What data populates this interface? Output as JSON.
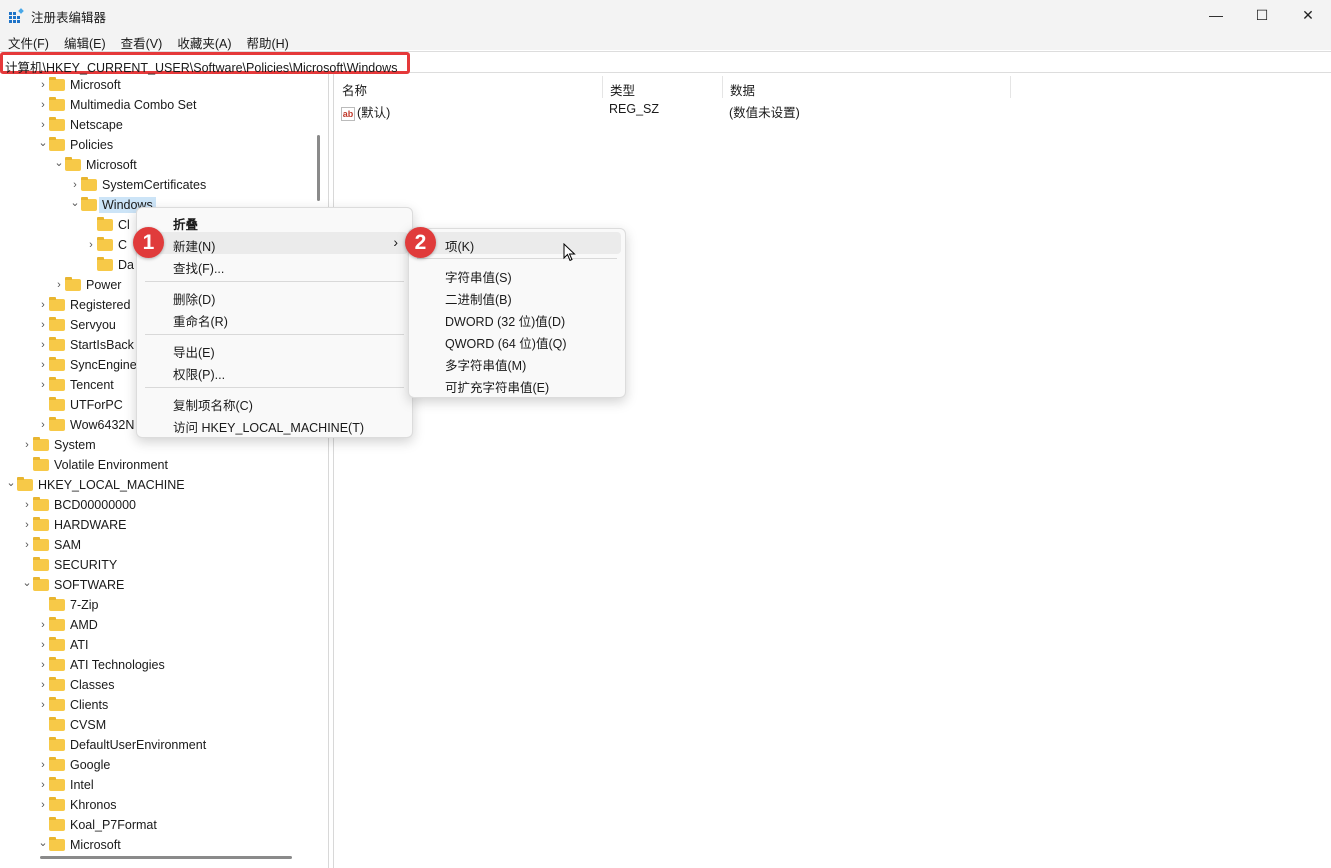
{
  "window": {
    "title": "注册表编辑器",
    "controls": {
      "minimize": "—",
      "maximize": "☐",
      "close": "✕"
    }
  },
  "menubar": [
    "文件(F)",
    "编辑(E)",
    "查看(V)",
    "收藏夹(A)",
    "帮助(H)"
  ],
  "address": "计算机\\HKEY_CURRENT_USER\\Software\\Policies\\Microsoft\\Windows",
  "tree": [
    {
      "label": "Microsoft",
      "level": 2,
      "state": "collapsed"
    },
    {
      "label": "Multimedia Combo Set",
      "level": 2,
      "state": "collapsed"
    },
    {
      "label": "Netscape",
      "level": 2,
      "state": "collapsed"
    },
    {
      "label": "Policies",
      "level": 2,
      "state": "expanded"
    },
    {
      "label": "Microsoft",
      "level": 3,
      "state": "expanded"
    },
    {
      "label": "SystemCertificates",
      "level": 4,
      "state": "collapsed"
    },
    {
      "label": "Windows",
      "level": 4,
      "state": "expanded",
      "selected": true
    },
    {
      "label": "Cl",
      "level": 5,
      "state": "leaf"
    },
    {
      "label": "C",
      "level": 5,
      "state": "collapsed"
    },
    {
      "label": "Da",
      "level": 5,
      "state": "leaf"
    },
    {
      "label": "Power",
      "level": 3,
      "state": "collapsed"
    },
    {
      "label": "Registered",
      "level": 2,
      "state": "collapsed"
    },
    {
      "label": "Servyou",
      "level": 2,
      "state": "collapsed"
    },
    {
      "label": "StartIsBack",
      "level": 2,
      "state": "collapsed"
    },
    {
      "label": "SyncEngine",
      "level": 2,
      "state": "collapsed"
    },
    {
      "label": "Tencent",
      "level": 2,
      "state": "collapsed"
    },
    {
      "label": "UTForPC",
      "level": 2,
      "state": "leaf"
    },
    {
      "label": "Wow6432N",
      "level": 2,
      "state": "collapsed"
    },
    {
      "label": "System",
      "level": 1,
      "state": "collapsed"
    },
    {
      "label": "Volatile Environment",
      "level": 1,
      "state": "leaf"
    },
    {
      "label": "HKEY_LOCAL_MACHINE",
      "level": 0,
      "state": "expanded"
    },
    {
      "label": "BCD00000000",
      "level": 1,
      "state": "collapsed"
    },
    {
      "label": "HARDWARE",
      "level": 1,
      "state": "collapsed"
    },
    {
      "label": "SAM",
      "level": 1,
      "state": "collapsed"
    },
    {
      "label": "SECURITY",
      "level": 1,
      "state": "leaf"
    },
    {
      "label": "SOFTWARE",
      "level": 1,
      "state": "expanded"
    },
    {
      "label": "7-Zip",
      "level": 2,
      "state": "leaf"
    },
    {
      "label": "AMD",
      "level": 2,
      "state": "collapsed"
    },
    {
      "label": "ATI",
      "level": 2,
      "state": "collapsed"
    },
    {
      "label": "ATI Technologies",
      "level": 2,
      "state": "collapsed"
    },
    {
      "label": "Classes",
      "level": 2,
      "state": "collapsed"
    },
    {
      "label": "Clients",
      "level": 2,
      "state": "collapsed"
    },
    {
      "label": "CVSM",
      "level": 2,
      "state": "leaf"
    },
    {
      "label": "DefaultUserEnvironment",
      "level": 2,
      "state": "leaf"
    },
    {
      "label": "Google",
      "level": 2,
      "state": "collapsed"
    },
    {
      "label": "Intel",
      "level": 2,
      "state": "collapsed"
    },
    {
      "label": "Khronos",
      "level": 2,
      "state": "collapsed"
    },
    {
      "label": "Koal_P7Format",
      "level": 2,
      "state": "leaf"
    },
    {
      "label": "Microsoft",
      "level": 2,
      "state": "expanded"
    }
  ],
  "values": {
    "columns": [
      "名称",
      "类型",
      "数据"
    ],
    "rows": [
      {
        "icon": "ab",
        "name": "(默认)",
        "type": "REG_SZ",
        "data": "(数值未设置)"
      }
    ]
  },
  "context_menu": {
    "items": [
      "折叠",
      "新建(N)",
      "查找(F)...",
      "删除(D)",
      "重命名(R)",
      "导出(E)",
      "权限(P)...",
      "复制项名称(C)",
      "访问 HKEY_LOCAL_MACHINE(T)"
    ],
    "submenu_arrow": "›"
  },
  "submenu": {
    "items": [
      "项(K)",
      "字符串值(S)",
      "二进制值(B)",
      "DWORD (32 位)值(D)",
      "QWORD (64 位)值(Q)",
      "多字符串值(M)",
      "可扩充字符串值(E)"
    ]
  },
  "badges": [
    "1",
    "2"
  ],
  "colors": {
    "highlight": "#e5393a",
    "selection": "#cce4f7",
    "folder": "#f7c948"
  }
}
